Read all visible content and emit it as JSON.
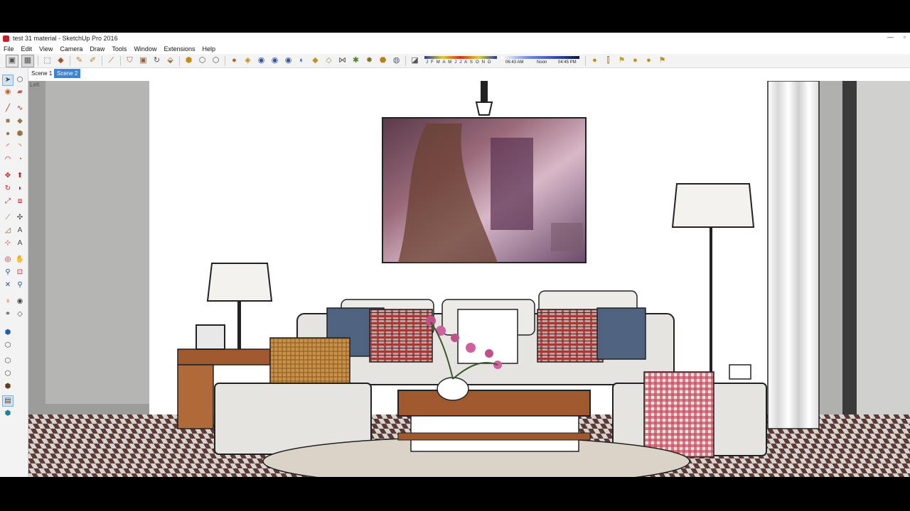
{
  "window": {
    "title": "test 31 material - SketchUp Pro 2016",
    "minimize": "—",
    "maximize": "▫"
  },
  "menu": [
    "File",
    "Edit",
    "View",
    "Camera",
    "Draw",
    "Tools",
    "Window",
    "Extensions",
    "Help"
  ],
  "shadows": {
    "months_label": "J F M A M J J A S O N D",
    "time_start": "06:43 AM",
    "time_mid": "Noon",
    "time_end": "04:45 PM"
  },
  "scenes": [
    {
      "label": "Scene 1",
      "active": false
    },
    {
      "label": "Scene 2",
      "active": true
    }
  ],
  "viewport": {
    "view_label": "Left"
  },
  "colors": {
    "accent": "#3b84d8",
    "wall": "#ffffff",
    "side_wall": "#b5b5b3",
    "floor_tile_dark": "#5a3a36",
    "floor_tile_light": "#d9d4cf",
    "sofa": "#e6e4e1",
    "pillow_plaid": "#b8524f",
    "pillow_blue": "#4f6380",
    "wood": "#b0663a",
    "wicker": "#c89048"
  },
  "toolbar_icons": [
    "new-file-icon",
    "open-icon",
    "select-icon",
    "make-component-icon",
    "paint-bucket-icon",
    "eraser-icon",
    "line-icon",
    "pencil-icon",
    "measure-icon",
    "component-icon",
    "push-pull-icon",
    "rotate-icon",
    "follow-me-icon",
    "iso-view-icon",
    "top-view-icon",
    "front-view-icon",
    "right-view-icon",
    "back-view-icon",
    "left-view-icon",
    "xray-icon",
    "wireframe-icon",
    "hidden-line-icon",
    "shaded-icon",
    "textured-icon",
    "monochrome-icon",
    "section-plane-icon",
    "shadows-toggle-icon",
    "sandbox-smoove-icon",
    "sandbox-stamp-icon",
    "sandbox-drape-icon",
    "sandbox-add-detail-icon",
    "sandbox-flip-icon"
  ],
  "palette_icons": [
    "select-icon",
    "component-icon",
    "paint-bucket-icon",
    "eraser-icon",
    "line-icon",
    "freehand-icon",
    "rectangle-icon",
    "rotated-rectangle-icon",
    "circle-icon",
    "polygon-icon",
    "arc-icon",
    "arc-2point-icon",
    "pie-icon",
    "arc-3point-icon",
    "move-icon",
    "push-pull-icon",
    "rotate-icon",
    "follow-me-icon",
    "scale-icon",
    "offset-icon",
    "tape-measure-icon",
    "dimension-icon",
    "protractor-icon",
    "text-icon",
    "axes-icon",
    "3d-text-icon",
    "orbit-icon",
    "pan-icon",
    "zoom-icon",
    "zoom-window-icon",
    "zoom-extents-icon",
    "previous-view-icon",
    "position-camera-icon",
    "look-around-icon",
    "walk-icon",
    "section-plane-icon",
    "warehouse-icon",
    "extension-icon",
    "share-model-icon",
    "layout-icon",
    "styles-icon",
    "materials-icon",
    "shadow-icon"
  ]
}
